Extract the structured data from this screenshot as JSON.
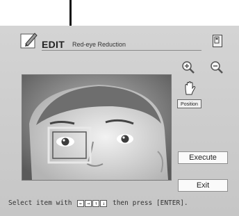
{
  "header": {
    "edit_label": "EDIT",
    "mode_title": "Red-eye Reduction"
  },
  "icons": {
    "edit": "pencil-edit-icon",
    "print": "print-preview-icon",
    "zoom_in": "zoom-in-icon",
    "zoom_out": "zoom-out-icon",
    "position": "hand-icon"
  },
  "controls": {
    "position_label": "Position",
    "execute_label": "Execute",
    "exit_label": "Exit"
  },
  "status": {
    "prefix": "Select item with",
    "arrows": [
      "←",
      "→",
      "↑",
      "↓"
    ],
    "suffix": "then press [ENTER]."
  },
  "colors": {
    "screen_bg": "#cfcfcf",
    "button_bg": "#fafafa",
    "selection_frame": "#e8e8e8"
  }
}
